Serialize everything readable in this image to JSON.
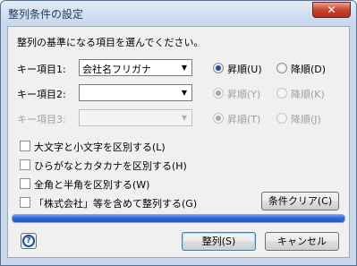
{
  "window": {
    "title": "整列条件の設定",
    "close_glyph": "✕"
  },
  "instruction": "整列の基準になる項目を選んでください。",
  "keys": [
    {
      "label": "キー項目1:",
      "value": "会社名フリガナ",
      "asc": "昇順(U)",
      "desc": "降順(D)",
      "enabled": true,
      "ascending": true
    },
    {
      "label": "キー項目2:",
      "value": "",
      "asc": "昇順(Y)",
      "desc": "降順(K)",
      "enabled": true,
      "ascending": true
    },
    {
      "label": "キー項目3:",
      "value": "",
      "asc": "昇順(T)",
      "desc": "降順(J)",
      "enabled": false,
      "ascending": true
    }
  ],
  "options": [
    {
      "label": "大文字と小文字を区別する(L)",
      "checked": false
    },
    {
      "label": "ひらがなとカタカナを区別する(H)",
      "checked": false
    },
    {
      "label": "全角と半角を区別する(W)",
      "checked": false
    },
    {
      "label": "「株式会社」等を含めて整列する(G)",
      "checked": false
    }
  ],
  "buttons": {
    "clear": "条件クリア(C)",
    "ok": "整列(S)",
    "cancel": "キャンセル",
    "help_glyph": "?"
  },
  "progress": {
    "value": 1.0
  },
  "colors": {
    "accent": "#2e62d4",
    "radio_selected": "#1c4fa3"
  },
  "icons": {
    "help": "help-icon",
    "dropdown": "chevron-down-icon"
  }
}
